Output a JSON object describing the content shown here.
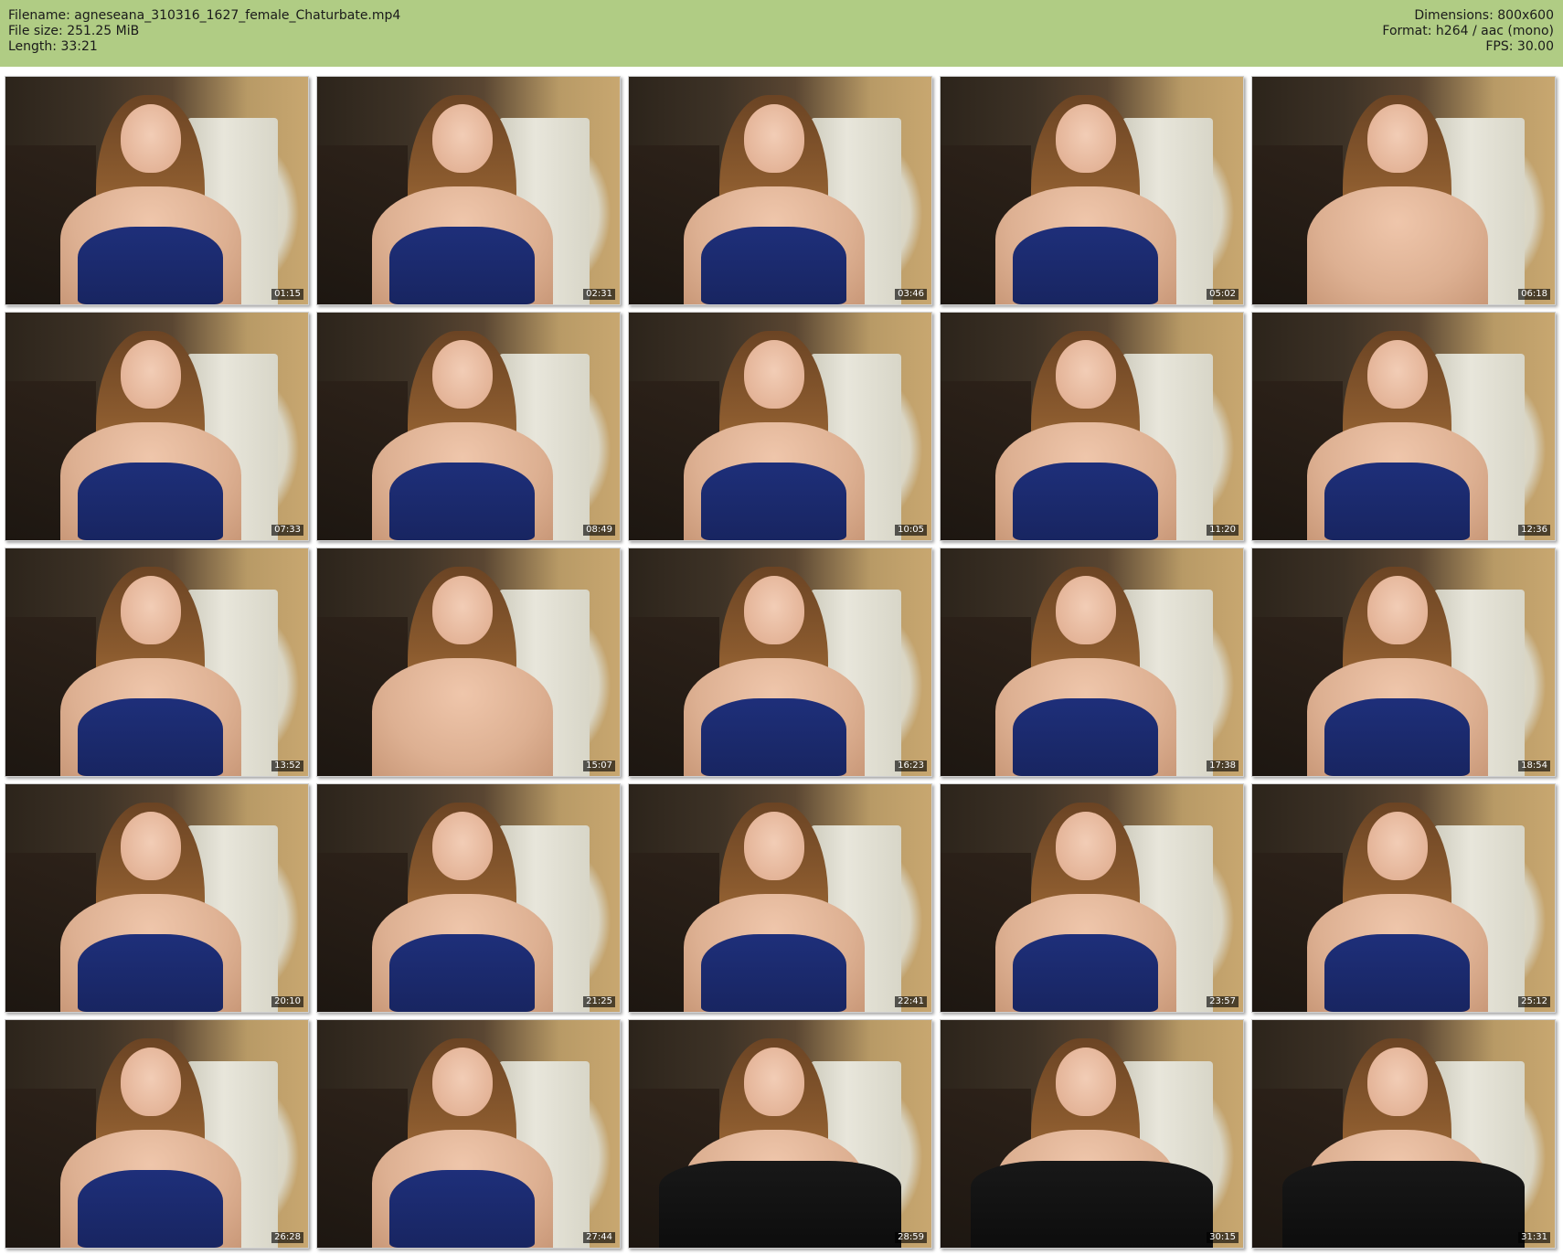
{
  "header": {
    "filename_line": "Filename: agneseana_310316_1627_female_Chaturbate.mp4",
    "filesize_line": "File size: 251.25 MiB",
    "length_line": "Length: 33:21",
    "dimensions_line": "Dimensions: 800x600",
    "format_line": "Format: h264 / aac (mono)",
    "fps_line": "FPS: 30.00",
    "background_color": "#b0cc84"
  },
  "thumbnails": [
    {
      "timestamp": "01:15",
      "top": "bra"
    },
    {
      "timestamp": "02:31",
      "top": "bra"
    },
    {
      "timestamp": "03:46",
      "top": "bra"
    },
    {
      "timestamp": "05:02",
      "top": "bra"
    },
    {
      "timestamp": "06:18",
      "top": "none"
    },
    {
      "timestamp": "07:33",
      "top": "bra"
    },
    {
      "timestamp": "08:49",
      "top": "bra"
    },
    {
      "timestamp": "10:05",
      "top": "bra"
    },
    {
      "timestamp": "11:20",
      "top": "bra"
    },
    {
      "timestamp": "12:36",
      "top": "bra"
    },
    {
      "timestamp": "13:52",
      "top": "bra"
    },
    {
      "timestamp": "15:07",
      "top": "none"
    },
    {
      "timestamp": "16:23",
      "top": "bra"
    },
    {
      "timestamp": "17:38",
      "top": "bra"
    },
    {
      "timestamp": "18:54",
      "top": "bra"
    },
    {
      "timestamp": "20:10",
      "top": "bra"
    },
    {
      "timestamp": "21:25",
      "top": "bra"
    },
    {
      "timestamp": "22:41",
      "top": "bra"
    },
    {
      "timestamp": "23:57",
      "top": "bra"
    },
    {
      "timestamp": "25:12",
      "top": "bra"
    },
    {
      "timestamp": "26:28",
      "top": "bra"
    },
    {
      "timestamp": "27:44",
      "top": "bra"
    },
    {
      "timestamp": "28:59",
      "top": "black"
    },
    {
      "timestamp": "30:15",
      "top": "black"
    },
    {
      "timestamp": "31:31",
      "top": "black"
    }
  ]
}
